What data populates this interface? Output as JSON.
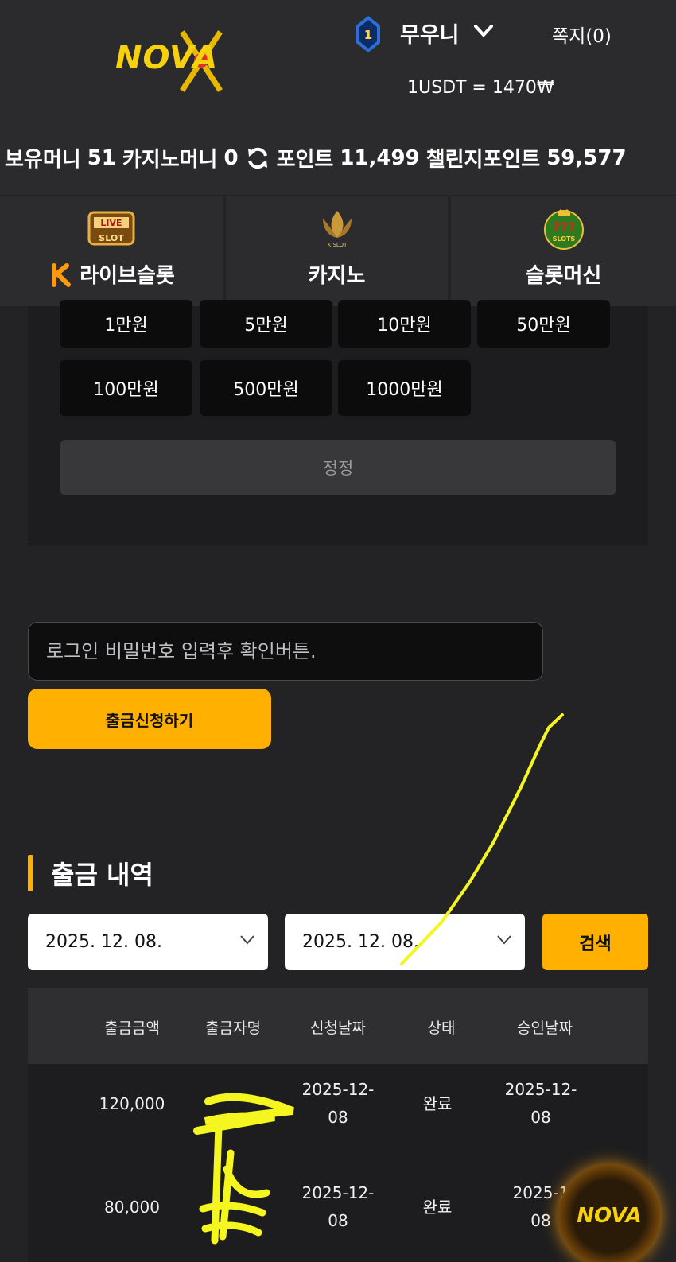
{
  "header": {
    "logo_text": "NOVA",
    "level": "1",
    "username": "무우니",
    "messages": "쪽지(0)",
    "rate": "1USDT = 1470₩"
  },
  "balances": {
    "money_label": "보유머니",
    "money": "51",
    "casino_label": "카지노머니",
    "casino": "0",
    "point_label": "포인트",
    "point": "11,499",
    "challenge_label": "챌린지포인트",
    "challenge": "59,577"
  },
  "tabs": [
    {
      "label": "라이브슬롯",
      "icon": "live-slot-icon",
      "icon_text": "LIVE SLOT"
    },
    {
      "label": "카지노",
      "icon": "k-slot-icon",
      "icon_text": "K SLOT"
    },
    {
      "label": "슬롯머신",
      "icon": "slots-777-icon",
      "icon_text": "777 SLOTS"
    }
  ],
  "amounts": [
    "1만원",
    "5만원",
    "10만원",
    "50만원",
    "100만원",
    "500만원",
    "1000만원"
  ],
  "reset_label": "정정",
  "password_placeholder": "로그인 비밀번호 입력후 확인버튼.",
  "withdraw_button": "출금신청하기",
  "history": {
    "title": "출금 내역",
    "date_from": "2025. 12. 08.",
    "date_to": "2025. 12. 08.",
    "search_label": "검색",
    "columns": [
      "출금금액",
      "출금자명",
      "신청날짜",
      "상태",
      "승인날짜"
    ],
    "rows": [
      {
        "amount": "120,000",
        "name": "",
        "req_date_1": "2025-12-",
        "req_date_2": "08",
        "status": "완료",
        "appr_date_1": "2025-12-",
        "appr_date_2": "08"
      },
      {
        "amount": "80,000",
        "name": "",
        "req_date_1": "2025-12-",
        "req_date_2": "08",
        "status": "완료",
        "appr_date_1": "2025-1",
        "appr_date_2": "08"
      }
    ]
  },
  "colors": {
    "accent": "#ffb000",
    "logo": "#f6d10d",
    "background": "#232325",
    "scribble": "#f5f520"
  }
}
